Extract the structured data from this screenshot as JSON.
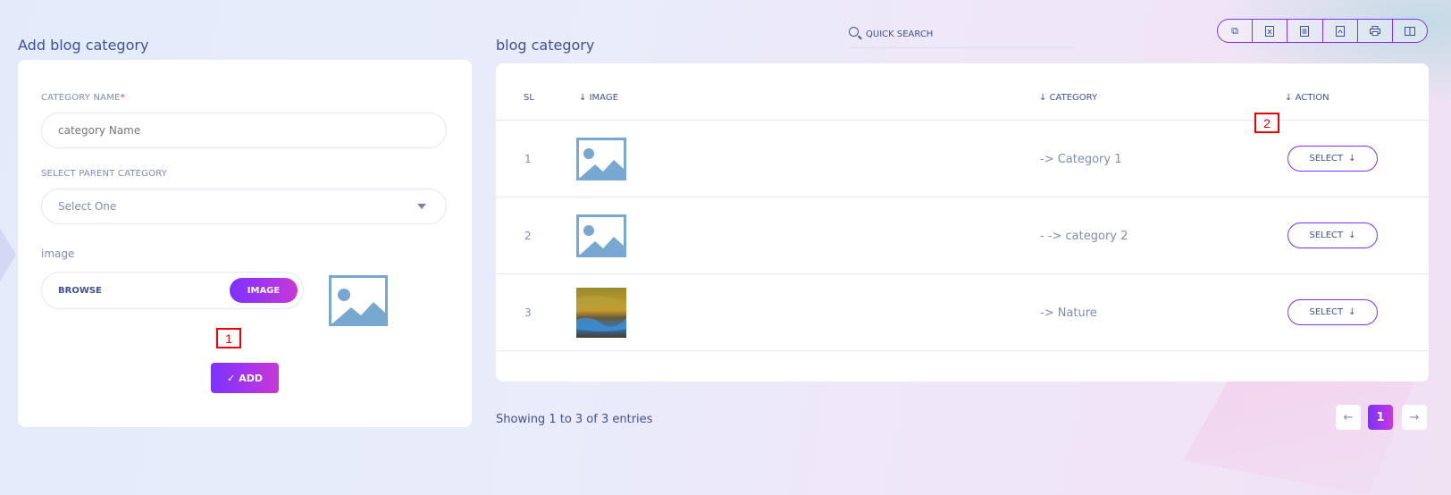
{
  "left": {
    "title": "Add blog category",
    "category_name_label": "CATEGORY NAME",
    "required_mark": "*",
    "category_name_placeholder": "category Name",
    "parent_label": "SELECT PARENT CATEGORY",
    "parent_selected": "Select One",
    "image_label": "image",
    "browse_text": "BROWSE",
    "image_button": "IMAGE",
    "add_button": "ADD",
    "marker": "1"
  },
  "search": {
    "placeholder": "QUICK SEARCH"
  },
  "toolbar": {
    "icons": [
      "copy-icon",
      "excel-icon",
      "csv-icon",
      "pdf-icon",
      "print-icon",
      "columns-icon"
    ]
  },
  "right": {
    "title": "blog category",
    "marker": "2",
    "columns": {
      "sl": "SL",
      "image": "IMAGE",
      "category": "CATEGORY",
      "action": "ACTION"
    },
    "rows": [
      {
        "sl": "1",
        "category": "-> Category 1",
        "action": "SELECT",
        "image": "placeholder"
      },
      {
        "sl": "2",
        "category": "- -> category 2",
        "action": "SELECT",
        "image": "placeholder"
      },
      {
        "sl": "3",
        "category": "-> Nature",
        "action": "SELECT",
        "image": "nature-photo"
      }
    ],
    "showing": "Showing 1 to 3 of 3 entries",
    "pagination": {
      "current": "1"
    }
  },
  "colors": {
    "accent_start": "#7c32ff",
    "accent_end": "#c738d8",
    "text": "#415094",
    "muted": "#828bb2"
  }
}
